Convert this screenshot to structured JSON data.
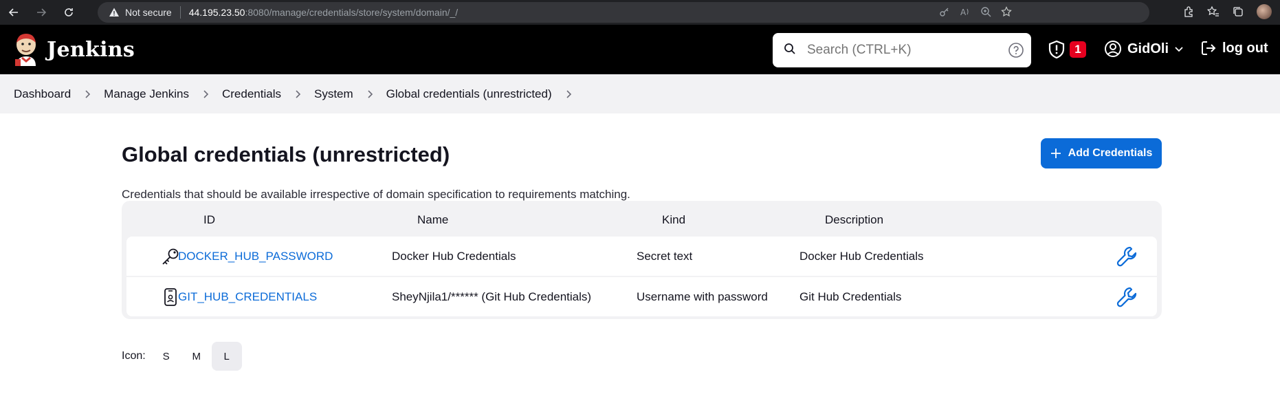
{
  "browser": {
    "security_label": "Not secure",
    "url_host": "44.195.23.50",
    "url_path": ":8080/manage/credentials/store/system/domain/_/"
  },
  "header": {
    "brand": "Jenkins",
    "search_placeholder": "Search (CTRL+K)",
    "alert_count": "1",
    "username": "GidOli",
    "logout_label": "log out"
  },
  "breadcrumb": [
    "Dashboard",
    "Manage Jenkins",
    "Credentials",
    "System",
    "Global credentials (unrestricted)"
  ],
  "page": {
    "title": "Global credentials (unrestricted)",
    "add_button_label": "Add Credentials",
    "description": "Credentials that should be available irrespective of domain specification to requirements matching."
  },
  "table": {
    "columns": [
      "ID",
      "Name",
      "Kind",
      "Description"
    ],
    "rows": [
      {
        "icon": "key-icon",
        "id": "DOCKER_HUB_PASSWORD",
        "name": "Docker Hub Credentials",
        "kind": "Secret text",
        "description": "Docker Hub Credentials"
      },
      {
        "icon": "id-badge-icon",
        "id": "GIT_HUB_CREDENTIALS",
        "name": "SheyNjila1/****** (Git Hub Credentials)",
        "kind": "Username with password",
        "description": "Git Hub Credentials"
      }
    ]
  },
  "icon_size": {
    "label": "Icon:",
    "options": [
      "S",
      "M",
      "L"
    ],
    "selected": "L"
  },
  "colors": {
    "accent": "#0b6bd8",
    "header_bg": "#000000",
    "alert": "#e6001f"
  }
}
